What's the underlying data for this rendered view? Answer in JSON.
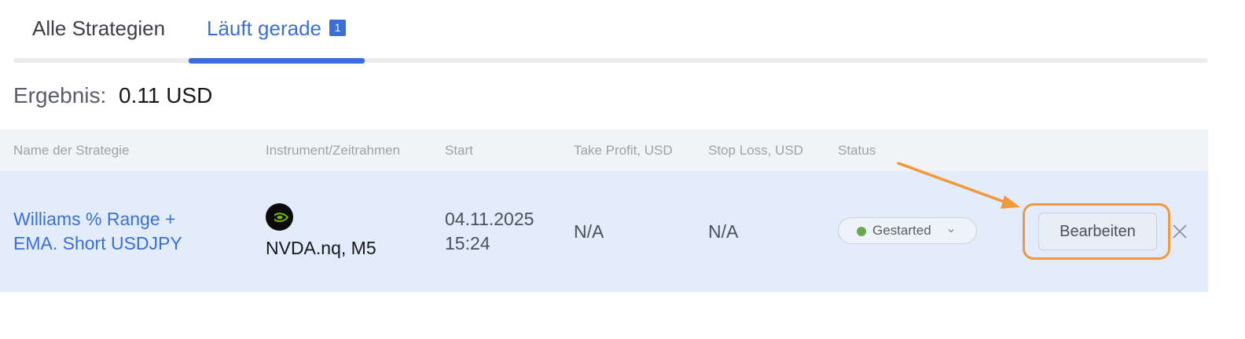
{
  "tabs": {
    "all_label": "Alle Strategien",
    "running_label": "Läuft gerade",
    "running_badge": "1"
  },
  "result": {
    "label": "Ergebnis:",
    "value": "0.11 USD"
  },
  "table": {
    "headers": {
      "name": "Name der Strategie",
      "instrument": "Instrument/Zeitrahmen",
      "start": "Start",
      "take_profit": "Take Profit, USD",
      "stop_loss": "Stop Loss, USD",
      "status": "Status"
    },
    "rows": [
      {
        "name_line1": "Williams % Range +",
        "name_line2": "EMA. Short USDJPY",
        "instrument_icon": "nvidia-logo-icon",
        "instrument": "NVDA.nq, M5",
        "start_date": "04.11.2025",
        "start_time": "15:24",
        "take_profit": "N/A",
        "stop_loss": "N/A",
        "status": "Gestarted",
        "edit_label": "Bearbeiten"
      }
    ]
  },
  "colors": {
    "accent": "#3a6fd8",
    "highlight": "#f0993a",
    "status_green": "#6aa84f",
    "row_background": "#e3ecfb"
  }
}
